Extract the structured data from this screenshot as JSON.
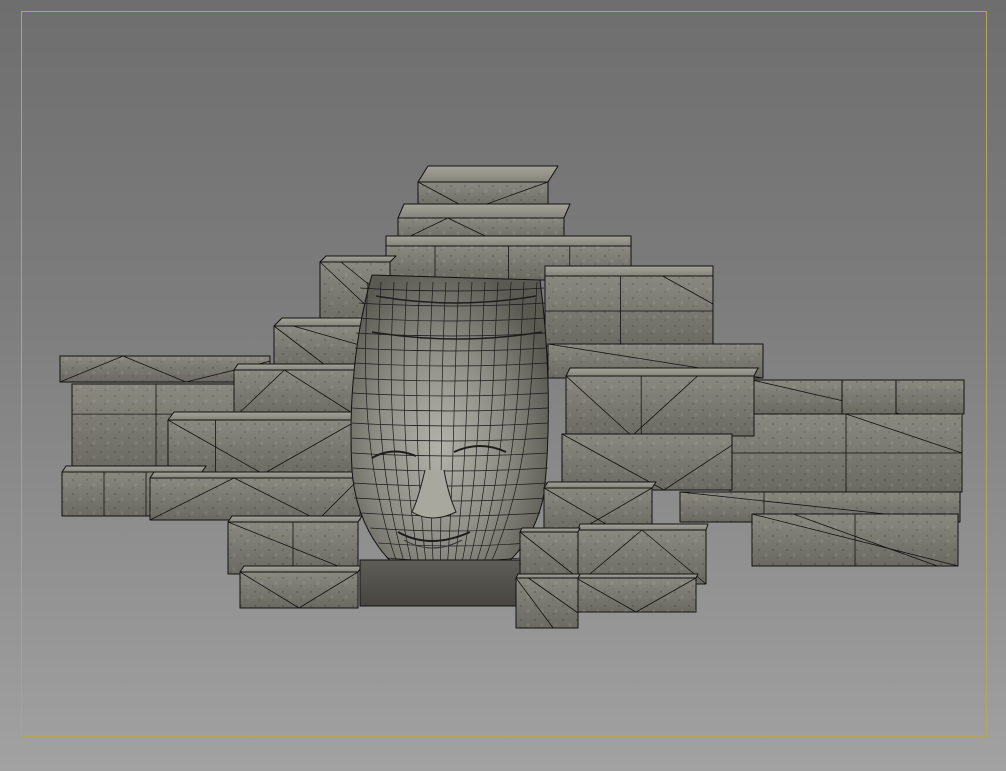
{
  "viewport": {
    "background_top": "#6e6e6e",
    "background_bottom": "#a2a2a2",
    "safe_frame_color": "#b8a260",
    "display_mode": "shaded-wireframe"
  },
  "model": {
    "subject": "stone-temple-face",
    "stone_color": "#7b7a72",
    "stone_dark": "#4e4d47",
    "stone_light": "#9a998f",
    "moss_color": "#6c7456",
    "edge_color": "#121212"
  }
}
